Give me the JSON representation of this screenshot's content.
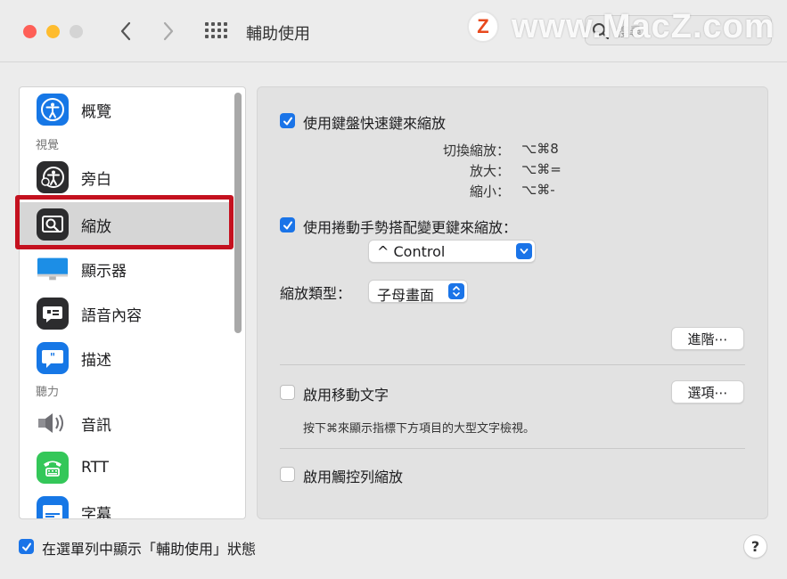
{
  "window": {
    "title": "輔助使用",
    "search_placeholder": "搜尋",
    "watermark": "www.MacZ.com",
    "watermark_logo": "Z"
  },
  "sidebar": {
    "items": [
      {
        "label": "概覽",
        "icon": "accessibility-icon"
      },
      {
        "section": "視覺"
      },
      {
        "label": "旁白",
        "icon": "voiceover-icon"
      },
      {
        "label": "縮放",
        "icon": "zoom-icon",
        "selected": true
      },
      {
        "label": "顯示器",
        "icon": "display-icon"
      },
      {
        "label": "語音內容",
        "icon": "spoken-content-icon"
      },
      {
        "label": "描述",
        "icon": "descriptions-icon"
      },
      {
        "section": "聽力"
      },
      {
        "label": "音訊",
        "icon": "audio-icon"
      },
      {
        "label": "RTT",
        "icon": "rtt-icon"
      },
      {
        "label": "字幕",
        "icon": "captions-icon"
      }
    ]
  },
  "zoom": {
    "keyboard_shortcuts": {
      "label": "使用鍵盤快速鍵來縮放",
      "checked": true,
      "shortcuts": [
        {
          "label": "切換縮放：",
          "keys": "⌥⌘8"
        },
        {
          "label": "放大：",
          "keys": "⌥⌘="
        },
        {
          "label": "縮小：",
          "keys": "⌥⌘-"
        }
      ]
    },
    "scroll_gesture": {
      "label": "使用捲動手勢搭配變更鍵來縮放：",
      "checked": true,
      "modifier": "^ Control"
    },
    "zoom_style": {
      "label": "縮放類型：",
      "value": "子母畫面"
    },
    "advanced_button": "進階⋯",
    "hover_text": {
      "label": "啟用移動文字",
      "checked": false,
      "options_button": "選項⋯",
      "hint": "按下⌘來顯示指標下方項目的大型文字檢視。"
    },
    "touch_bar_zoom": {
      "label": "啟用觸控列縮放",
      "checked": false
    }
  },
  "footer": {
    "menu_bar_checkbox": "在選單列中顯示「輔助使用」狀態",
    "menu_bar_checked": true,
    "help": "?"
  },
  "colors": {
    "accent": "#1a74e8",
    "highlight_border": "#c4111f",
    "close": "#fe5f57",
    "minimize": "#febc2e"
  }
}
